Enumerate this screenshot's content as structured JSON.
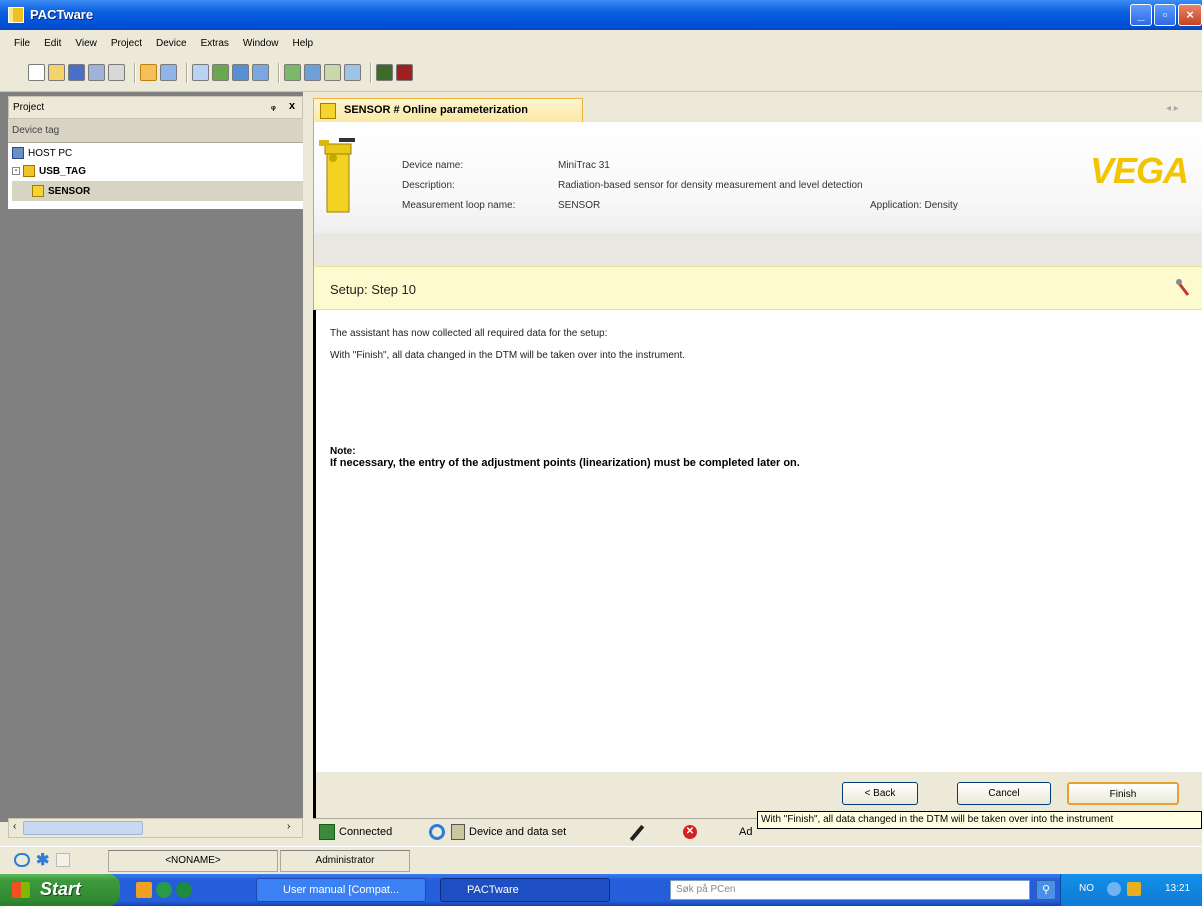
{
  "window": {
    "title": "PACTware"
  },
  "menu": [
    "File",
    "Edit",
    "View",
    "Project",
    "Device",
    "Extras",
    "Window",
    "Help"
  ],
  "project_panel": {
    "title": "Project",
    "pin_glyph": "ᵩ",
    "close_glyph": "x",
    "column_header": "Device tag",
    "tree": [
      {
        "label": "HOST PC",
        "icon": "computer-icon"
      },
      {
        "label": "USB_TAG",
        "icon": "usb-icon"
      },
      {
        "label": "SENSOR",
        "icon": "sensor-icon"
      }
    ]
  },
  "tab": {
    "label": "SENSOR # Online parameterization"
  },
  "device": {
    "name_label": "Device name:",
    "name_value": "MiniTrac 31",
    "desc_label": "Description:",
    "desc_value": "Radiation-based sensor for density measurement and level detection",
    "loop_label": "Measurement loop name:",
    "loop_value": "SENSOR",
    "application": "Application: Density",
    "brand": "VEGA"
  },
  "step": {
    "title": "Setup: Step 10"
  },
  "content": {
    "line1": "The assistant has now collected all required data for the setup:",
    "line2": "With \"Finish\", all data changed in the DTM will be taken over into the instrument.",
    "note_title": "Note:",
    "note_text": "If necessary, the entry of the adjustment points (linearization) must be completed later on."
  },
  "buttons": {
    "back": "< Back",
    "cancel": "Cancel",
    "finish": "Finish"
  },
  "status": {
    "connected": "Connected",
    "device_data": "Device and data set",
    "user": "Administrator",
    "user_clipped": "Ad"
  },
  "tooltip": "With \"Finish\", all data changed in the DTM will be taken over into the instrument",
  "bottom": {
    "noname": "<NONAME>",
    "user": "Administrator"
  },
  "taskbar": {
    "start": "Start",
    "tasks": [
      "User manual [Compat...",
      "PACTware"
    ],
    "search_placeholder": "Søk på PCen",
    "lang": "NO",
    "time": "13:21"
  }
}
